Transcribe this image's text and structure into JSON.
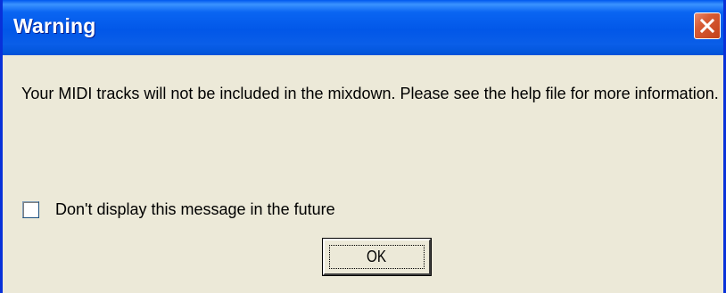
{
  "dialog": {
    "title": "Warning",
    "message": "Your MIDI tracks will not be included in the mixdown.  Please see the help file for more information.",
    "checkbox_label": "Don't display this message in the future",
    "checkbox_checked": false,
    "ok_label": "OK",
    "close_icon": "close-icon"
  },
  "colors": {
    "titlebar": "#0a5ee8",
    "window_frame": "#0831d9",
    "dialog_face": "#ece9d8",
    "close_button": "#d85c35"
  }
}
